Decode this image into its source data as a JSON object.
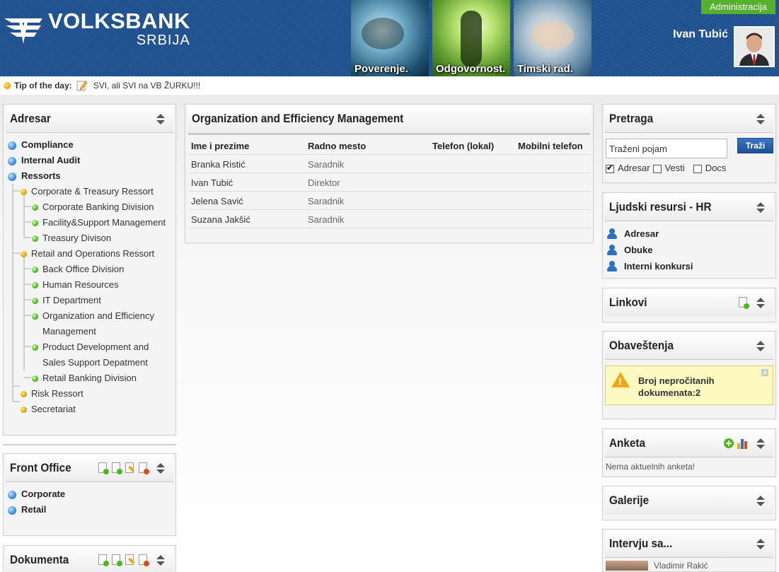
{
  "header": {
    "logo_line1": "VOLKSBANK",
    "logo_line2": "SRBIJA",
    "hero_captions": [
      "Poverenje.",
      "Odgovornost.",
      "Timski rad."
    ],
    "admin_label": "Administracija",
    "user_name": "Ivan Tubić"
  },
  "tip": {
    "label": "Tip of the day:",
    "text": "SVI, ali SVI na VB ŽURKU!!!"
  },
  "adresar": {
    "title": "Adresar",
    "roots": [
      "Compliance",
      "Internal Audit",
      "Ressorts"
    ],
    "tree": [
      {
        "label": "Corporate & Treasury Ressort",
        "children": [
          "Corporate Banking Division",
          "Facility&Support Management",
          "Treasury Divison"
        ]
      },
      {
        "label": "Retail and Operations Ressort",
        "children": [
          "Back Office Division",
          "Human Resources",
          "IT Department",
          "Organization and Efficiency Management",
          "Product Development and Sales Support Depatment",
          "Retail Banking Division"
        ]
      },
      {
        "label": "Risk Ressort",
        "children": []
      },
      {
        "label": "Secretariat",
        "children": []
      }
    ]
  },
  "front_office": {
    "title": "Front Office",
    "items": [
      "Corporate",
      "Retail"
    ]
  },
  "dokumenta": {
    "title": "Dokumenta"
  },
  "main": {
    "title": "Organization and Efficiency Management",
    "columns": [
      "Ime i prezime",
      "Radno mesto",
      "Telefon (lokal)",
      "Mobilni telefon"
    ],
    "rows": [
      {
        "name": "Branka Ristić",
        "role": "Saradnik"
      },
      {
        "name": "Ivan Tubić",
        "role": "Direktor"
      },
      {
        "name": "Jelena Savić",
        "role": "Saradnik"
      },
      {
        "name": "Suzana Jakšić",
        "role": "Saradnik"
      }
    ]
  },
  "pretraga": {
    "title": "Pretraga",
    "input_value": "Traženi pojam",
    "button": "Traži",
    "options": [
      {
        "label": "Adresar",
        "checked": true
      },
      {
        "label": "Vesti",
        "checked": false
      },
      {
        "label": "Docs",
        "checked": false
      }
    ]
  },
  "hr": {
    "title": "Ljudski resursi - HR",
    "items": [
      "Adresar",
      "Obuke",
      "Interni konkursi"
    ]
  },
  "linkovi": {
    "title": "Linkovi"
  },
  "obavestenja": {
    "title": "Obaveštenja",
    "notice_line1": "Broj nepročitanih",
    "notice_line2": "dokumenata:2"
  },
  "anketa": {
    "title": "Anketa",
    "note": "Nema aktuelnih anketa!"
  },
  "galerije": {
    "title": "Galerije"
  },
  "intervju": {
    "title": "Intervju sa...",
    "person": "Vladimir Rakić"
  },
  "colors": {
    "header_blue": "#1d4f8e",
    "admin_green": "#55b02c",
    "notice_bg": "#fdf9c0",
    "button_blue": "#2a5fab"
  }
}
